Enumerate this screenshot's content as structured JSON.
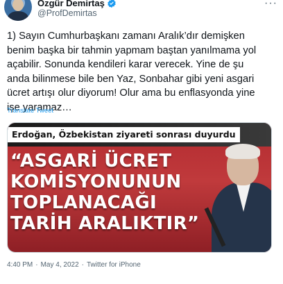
{
  "author": {
    "display_name": "Özgür Demirtaş",
    "handle": "@ProfDemirtas"
  },
  "tweet": {
    "text": "1) Sayın Cumhurbaşkanı zamanı Aralık’dır demişken\nbenim başka bir tahmin yapmam baştan yanılmama yol\naçabilir. Sonunda kendileri karar verecek. Yine de şu\nanda bilinmese bile ben Yaz, Sonbahar gibi yeni asgari\nücret artışı olur diyorum! Olur ama bu enflasyonda yine\nişe yaramaz…",
    "translate_label": "Translate Tweet"
  },
  "media": {
    "caption": "Erdoğan, Özbekistan ziyareti sonrası duyurdu",
    "headline_lines": [
      "“ASGARİ ÜCRET",
      "KOMİSYONUNUN",
      "TOPLANACAĞI",
      "TARİH ARALIKTIR”"
    ]
  },
  "meta": {
    "time": "4:40 PM",
    "separator": "·",
    "date": "May 4, 2022",
    "source": "Twitter for iPhone"
  },
  "colors": {
    "link": "#1d9bf0",
    "verified": "#1d9bf0",
    "secondary_text": "#536471"
  },
  "icons": {
    "verified": "verified-badge-icon",
    "more": "more-options-icon"
  }
}
